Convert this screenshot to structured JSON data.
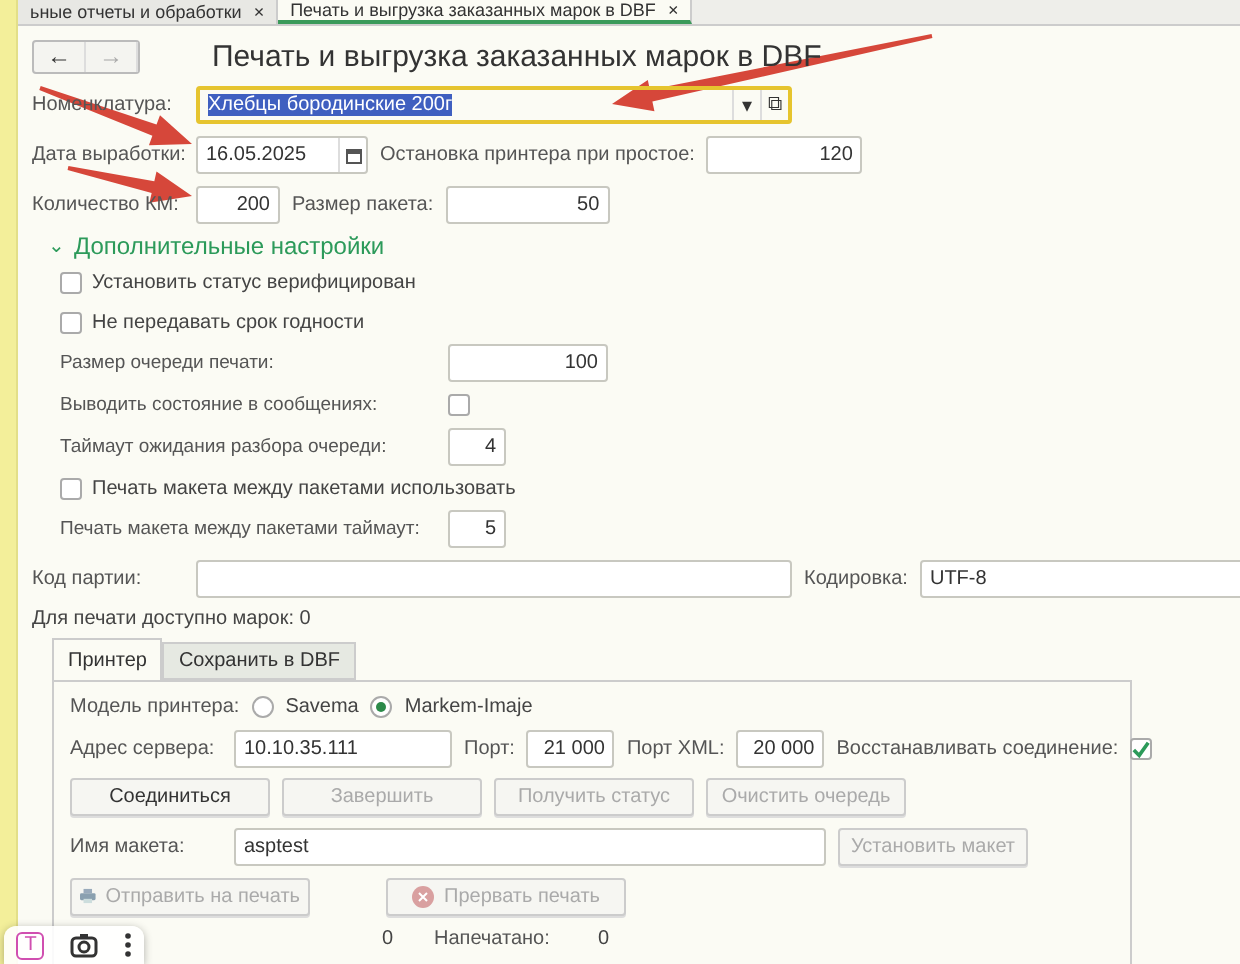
{
  "doc_tabs": [
    {
      "label": "ьные отчеты и обработки",
      "close": "×",
      "selected": false
    },
    {
      "label": "Печать и выгрузка заказанных марок в DBF",
      "close": "×",
      "selected": true
    }
  ],
  "nav": {
    "back": "←",
    "forward": "→",
    "forward_disabled": true
  },
  "title": "Печать и выгрузка заказанных марок в DBF",
  "nomenclature": {
    "label": "Номенклатура:",
    "value": "Хлебцы бородинские 200г",
    "selected_text": true,
    "dropdown": "▾",
    "open": "⧉"
  },
  "date": {
    "label": "Дата выработки:",
    "value": "16.05.2025"
  },
  "printer_stop": {
    "label": "Остановка принтера при простое:",
    "value": "120"
  },
  "count": {
    "label": "Количество КМ:",
    "value": "200"
  },
  "package": {
    "label": "Размер пакета:",
    "value": "50"
  },
  "section": {
    "title": "Дополнительные настройки",
    "chevron": "⌄",
    "expanded": true
  },
  "settings": [
    {
      "kind": "checkbox",
      "label": "Установить статус верифицирован",
      "checked": false
    },
    {
      "kind": "checkbox",
      "label": "Не передавать срок годности",
      "checked": false
    },
    {
      "kind": "number",
      "label": "Размер очереди печати:",
      "value": "100",
      "wide": true
    },
    {
      "kind": "flag",
      "label": "Выводить состояние в сообщениях:",
      "checked": false
    },
    {
      "kind": "number",
      "label": "Таймаут ожидания разбора очереди:",
      "value": "4",
      "wide": false
    },
    {
      "kind": "checkbox",
      "label": "Печать макета между пакетами использовать",
      "checked": false
    },
    {
      "kind": "number",
      "label": "Печать макета между пакетами таймаут:",
      "value": "5",
      "wide": false
    }
  ],
  "batch": {
    "label": "Код партии:"
  },
  "encoding": {
    "label": "Кодировка:",
    "value": "UTF-8"
  },
  "available": "Для печати доступно марок: 0",
  "tabs": [
    {
      "label": "Принтер",
      "selected": true
    },
    {
      "label": "Сохранить в DBF",
      "selected": false
    }
  ],
  "model": {
    "label": "Модель принтера:",
    "options": [
      {
        "label": "Savema",
        "selected": false
      },
      {
        "label": "Markem-Imaje",
        "selected": true
      }
    ]
  },
  "server": {
    "label": "Адрес сервера:",
    "value": "10.10.35.111"
  },
  "port": {
    "label": "Порт:",
    "value": "21 000"
  },
  "port_xml": {
    "label": "Порт XML:",
    "value": "20 000"
  },
  "reconnect": {
    "label": "Восстанавливать соединение:",
    "checked": true
  },
  "actions": [
    {
      "label": "Соединиться",
      "disabled": false
    },
    {
      "label": "Завершить",
      "disabled": true
    },
    {
      "label": "Получить статус",
      "disabled": true
    },
    {
      "label": "Очистить очередь",
      "disabled": true
    }
  ],
  "layout": {
    "label": "Имя макета:",
    "value": "asptest",
    "button": "Установить макет",
    "button_disabled": true
  },
  "print_actions": [
    {
      "kind": "print",
      "label": "Отправить на печать",
      "disabled": true
    },
    {
      "kind": "stop",
      "label": "Прервать печать",
      "disabled": true
    }
  ],
  "counters": [
    {
      "value": "0"
    },
    {
      "label": "Напечатано:",
      "value": "0"
    }
  ],
  "overlay_toolbar": {
    "text_tool": "T"
  }
}
